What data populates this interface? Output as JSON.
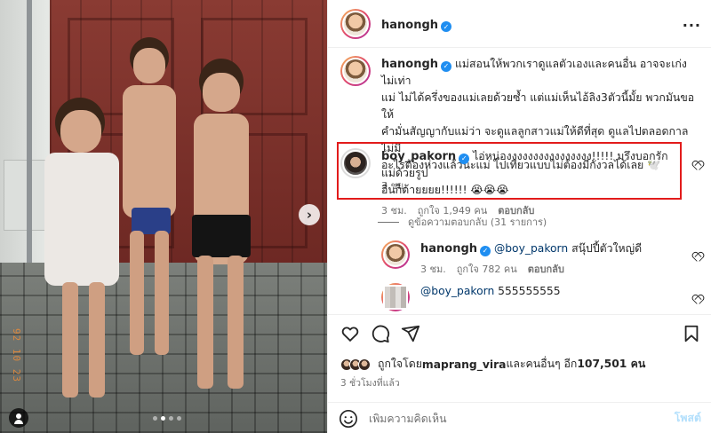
{
  "header": {
    "username": "hanongh",
    "more_icon": "more-horizontal-icon"
  },
  "photo": {
    "date_stamp": "92 10 23",
    "image_count": 4,
    "active_index": 1
  },
  "caption": {
    "username": "hanongh",
    "text_line1": "แม่สอนให้พวกเราดูแลตัวเองและคนอื่น อาจจะเก่งไม่เท่า",
    "text_line2": "แม่ ไม่ได้ครึ่งของแม่เลยด้วยซ้ำ แต่แม่เห็นไอ้ลิง3ตัวนี้มั้ย พวกมันขอให้",
    "text_line3": "คำมั่นสัญญากับแม่ว่า จะดูแลลูกสาวแม่ให้ดีที่สุด ดูแลไปตลอดกาล ไม่มี",
    "text_line4": "อะไรต้องห่วงแล้วนะแม่ ไปเที่ยวแบบไม่ต้องมีกังวลได้เลย 🕊️",
    "time": "3 ชม."
  },
  "comments": [
    {
      "username": "boy_pakorn",
      "text_line1": "ไอ่หน่องงงงงงงงงงงงงงงง!!!!! มรึงบอกรักแม่ด้วยรูป",
      "text_line2": "อื่นก็ด้ายยยย!!!!!! 😭😭😭",
      "time": "3 ชม.",
      "likes": "ถูกใจ 1,949 คน",
      "reply": "ตอบกลับ"
    }
  ],
  "view_replies": "ดูข้อความตอบกลับ (31 รายการ)",
  "replies": [
    {
      "username": "hanongh",
      "mention": "@boy_pakorn",
      "text": " สนุ๊ปปี้ตัวใหญ่ดี",
      "time": "3 ชม.",
      "likes": "ถูกใจ 782 คน",
      "reply": "ตอบกลับ"
    },
    {
      "mention": "@boy_pakorn",
      "text": " 555555555"
    }
  ],
  "likes_line": {
    "prefix": "ถูกใจโดย ",
    "user": "maprang_vira",
    "middle": " และคนอื่นๆ อีก ",
    "count": "107,501 คน"
  },
  "time_ago": "3 ชั่วโมงที่แล้ว",
  "add_comment": {
    "placeholder": "เพิ่มความคิดเห็น",
    "post_label": "โพสต์"
  },
  "colors": {
    "highlight": "#e21b1b",
    "verified": "#1f8ef1",
    "post_button": "#b2dffc",
    "link": "#00376b"
  }
}
